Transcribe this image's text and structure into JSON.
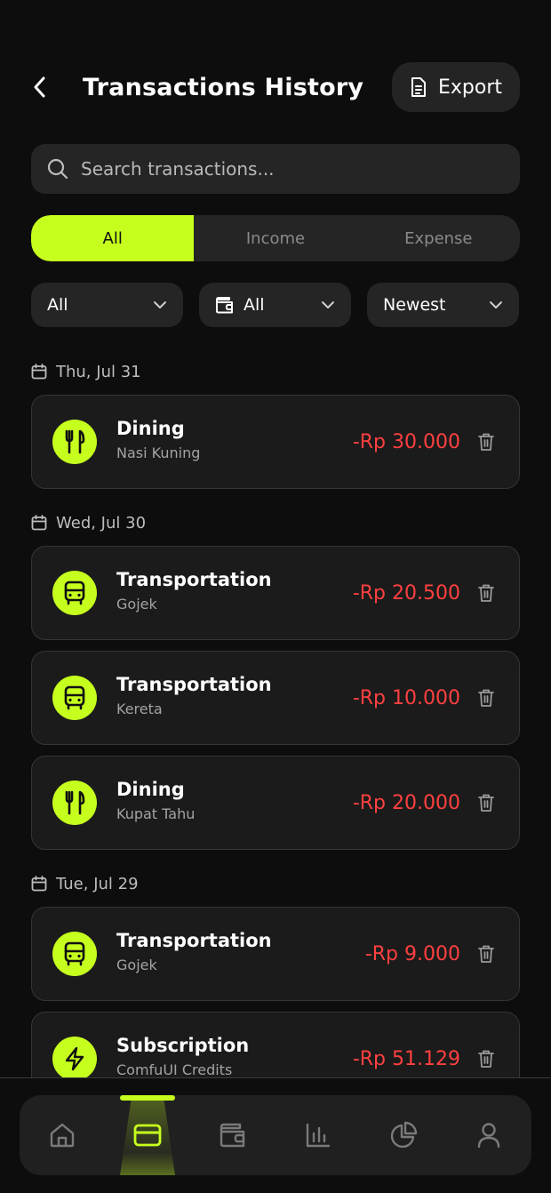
{
  "header": {
    "title": "Transactions History",
    "export_label": "Export"
  },
  "search": {
    "placeholder": "Search transactions..."
  },
  "segments": [
    "All",
    "Income",
    "Expense"
  ],
  "filters": {
    "category": "All",
    "wallet": "All",
    "sort": "Newest"
  },
  "groups": [
    {
      "date": "Thu, Jul 31",
      "items": [
        {
          "category": "Dining",
          "note": "Nasi Kuning",
          "amount": "-Rp 30.000",
          "icon": "utensils-icon"
        }
      ]
    },
    {
      "date": "Wed, Jul 30",
      "items": [
        {
          "category": "Transportation",
          "note": "Gojek",
          "amount": "-Rp 20.500",
          "icon": "bus-icon"
        },
        {
          "category": "Transportation",
          "note": "Kereta",
          "amount": "-Rp 10.000",
          "icon": "bus-icon"
        },
        {
          "category": "Dining",
          "note": "Kupat Tahu",
          "amount": "-Rp 20.000",
          "icon": "utensils-icon"
        }
      ]
    },
    {
      "date": "Tue, Jul 29",
      "items": [
        {
          "category": "Transportation",
          "note": "Gojek",
          "amount": "-Rp 9.000",
          "icon": "bus-icon"
        },
        {
          "category": "Subscription",
          "note": "ComfuUI Credits",
          "amount": "-Rp 51.129",
          "icon": "bolt-icon"
        }
      ]
    }
  ],
  "nav": [
    "home-icon",
    "card-icon",
    "wallet-icon",
    "bar-chart-icon",
    "pie-chart-icon",
    "user-icon"
  ],
  "colors": {
    "accent": "#c6ff1e",
    "expense": "#ff4040",
    "background": "#0d0d0d",
    "card": "#1b1b1b"
  }
}
